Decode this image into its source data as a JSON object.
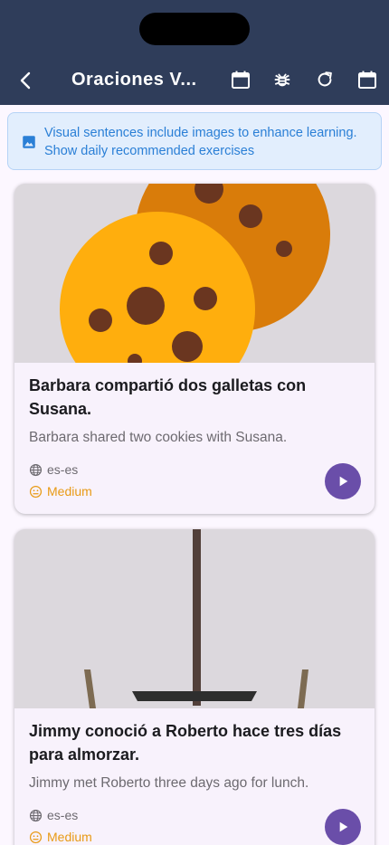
{
  "header": {
    "title": "Oraciones V...",
    "back_icon": "chevron-left-icon",
    "actions": [
      "calendar-icon",
      "bug-icon",
      "refresh-icon",
      "calendar-icon"
    ],
    "background": "#2f3d5a"
  },
  "banner": {
    "icon": "image-icon",
    "text": "Visual sentences include images to enhance learning. Show daily recommended exercises"
  },
  "cards": [
    {
      "sentence": "Barbara compartió dos galletas con Susana.",
      "translation": "Barbara shared two cookies with Susana.",
      "language": "es-es",
      "difficulty": "Medium",
      "image": "cookies"
    },
    {
      "sentence": "Jimmy conoció a Roberto hace tres días para almorzar.",
      "translation": "Jimmy met Roberto three days ago for lunch.",
      "language": "es-es",
      "difficulty": "Medium",
      "image": "table"
    }
  ],
  "colors": {
    "accent": "#6a4ea9",
    "medium": "#e89a14",
    "banner_text": "#2a7fd6"
  }
}
